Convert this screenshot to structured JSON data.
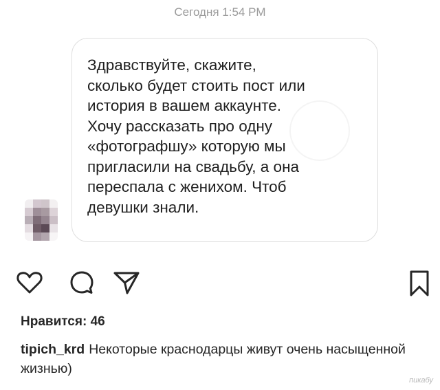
{
  "thread": {
    "timestamp": "Сегодня 1:54 PM",
    "message": "Здравствуйте, скажите,\nсколько будет стоить пост или\nистория в вашем аккаунте.\nХочу рассказать про одну\n«фотографшу» которую мы\nпригласили на свадьбу, а она\nпереспала с женихом. Чтоб\nдевушки знали."
  },
  "actions": {
    "icons": [
      "heart-icon",
      "comment-icon",
      "share-icon",
      "bookmark-icon"
    ]
  },
  "post": {
    "likes": "Нравится: 46",
    "username": "tipich_krd",
    "caption": "Некоторые краснодарцы живут очень насыщенной жизнью)"
  },
  "site_watermark": "пикабу"
}
